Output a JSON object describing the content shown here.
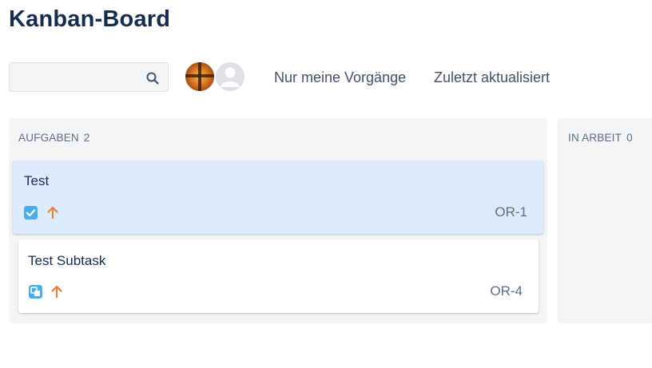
{
  "board": {
    "title": "Kanban-Board"
  },
  "toolbar": {
    "search": {
      "value": "",
      "placeholder": ""
    },
    "filters": {
      "only_my_issues": "Nur meine Vorgänge",
      "recently_updated": "Zuletzt aktualisiert"
    }
  },
  "columns": [
    {
      "name": "AUFGABEN",
      "count": "2",
      "cards": [
        {
          "title": "Test",
          "key": "OR-1",
          "type_icon": "task-checkbox-icon",
          "priority_icon": "priority-high-arrow-icon",
          "selected": true
        },
        {
          "title": "Test Subtask",
          "key": "OR-4",
          "type_icon": "subtask-icon",
          "priority_icon": "priority-high-arrow-icon",
          "selected": false
        }
      ]
    },
    {
      "name": "IN ARBEIT",
      "count": "0",
      "cards": []
    }
  ],
  "colors": {
    "selected_card": "#deebff",
    "task_icon": "#4bade8",
    "priority_arrow": "#e97f33",
    "column_bg": "#f4f5f7"
  }
}
